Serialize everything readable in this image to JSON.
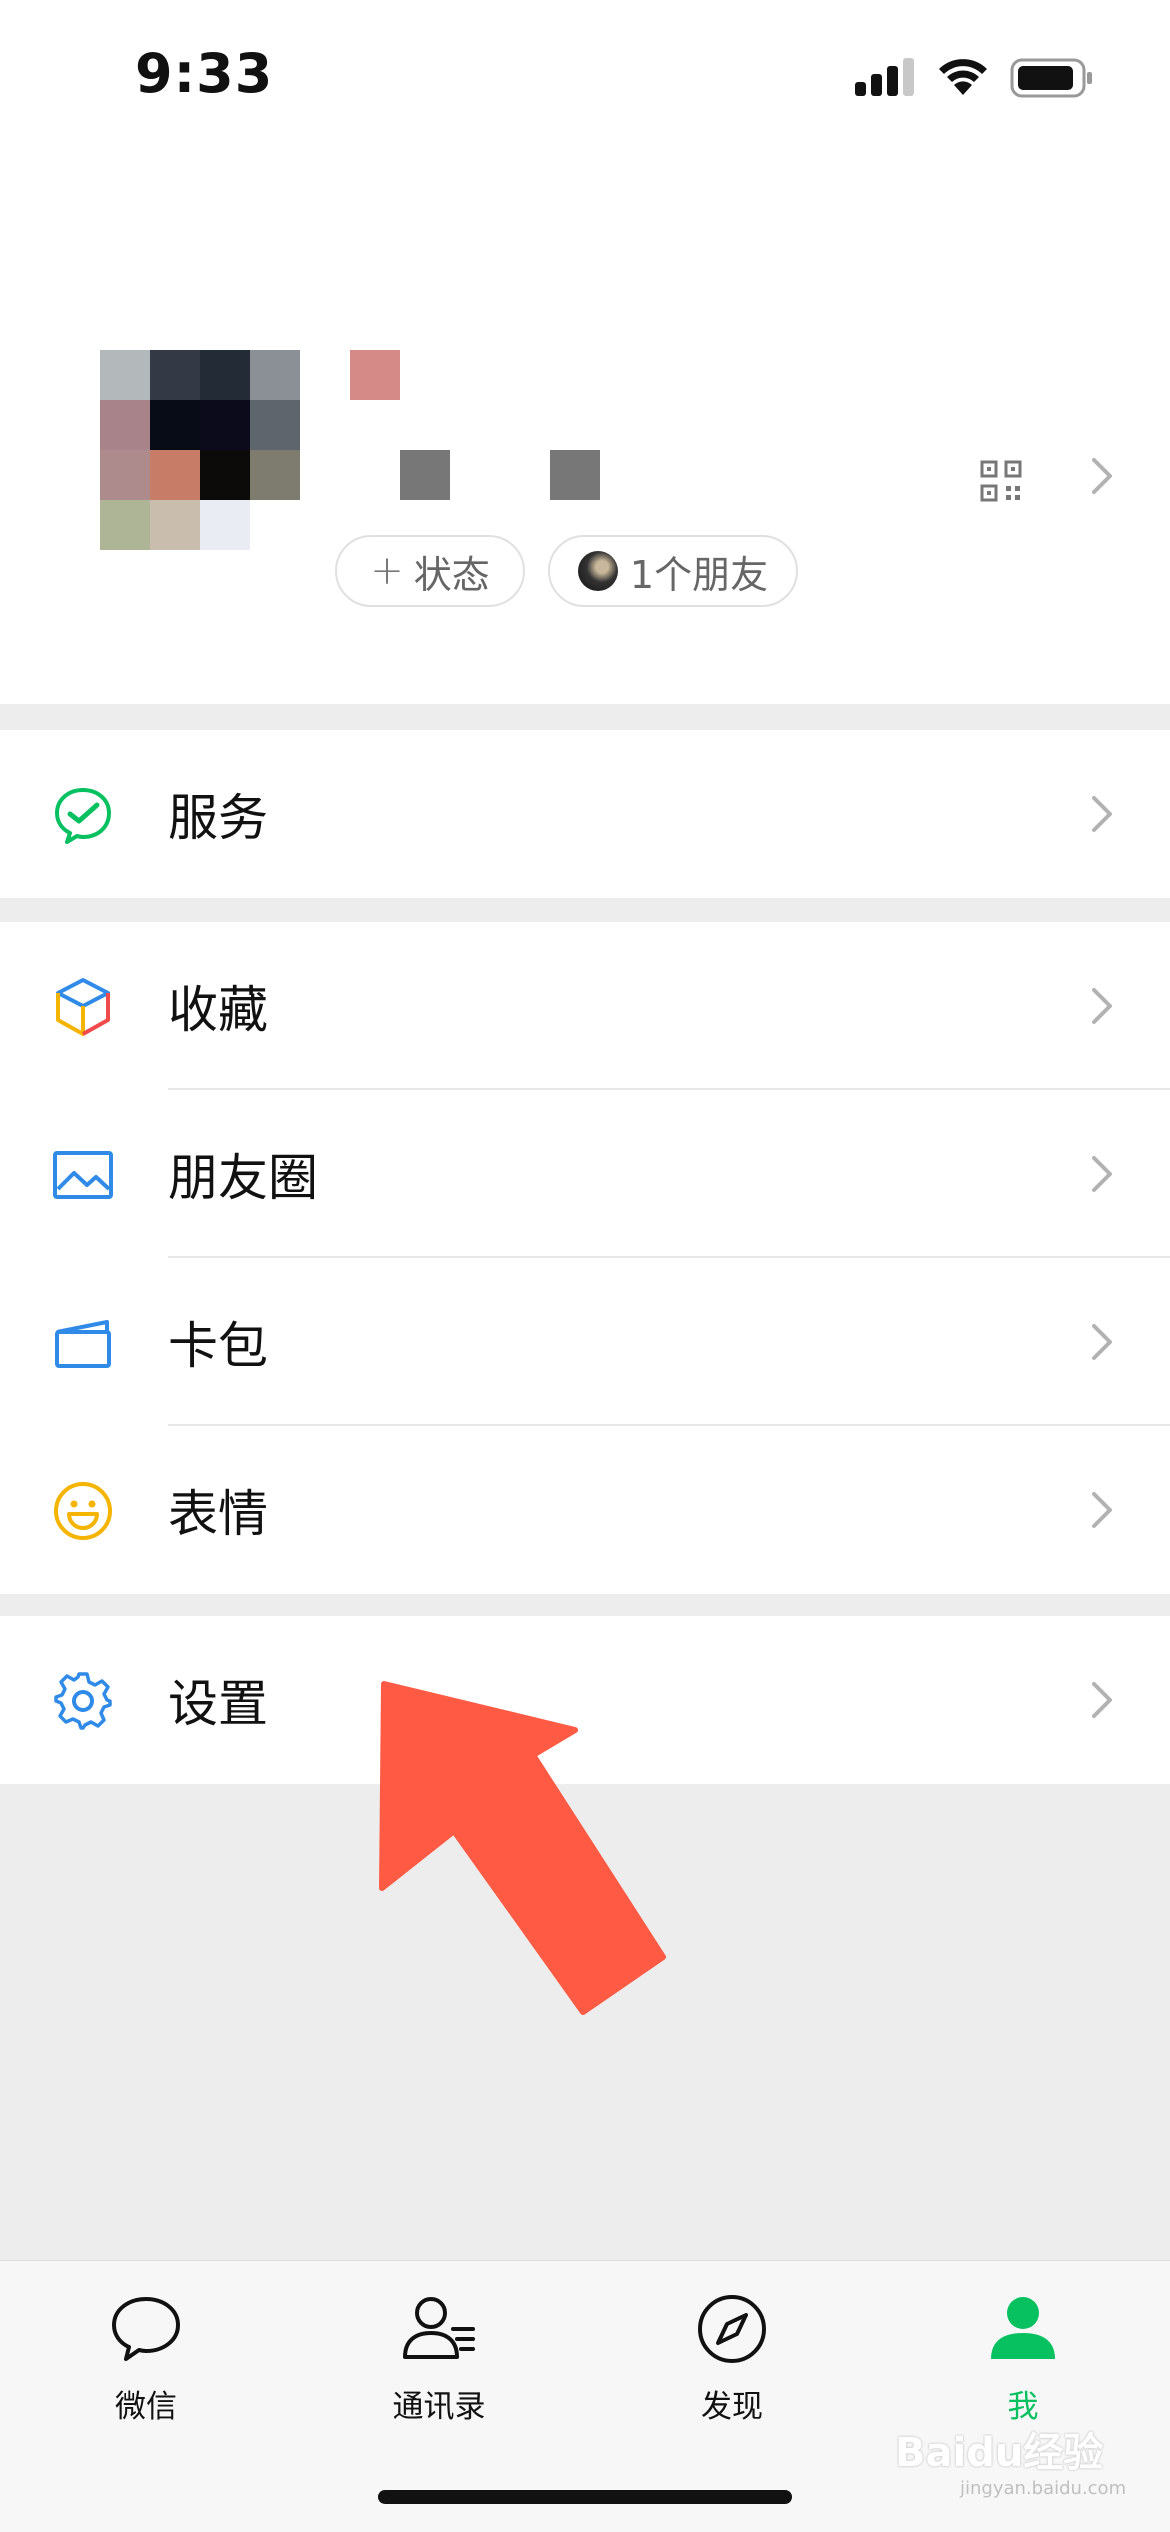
{
  "status_bar": {
    "time": "9:33"
  },
  "profile": {
    "status_chip_label": "状态",
    "friends_chip_label": "1个朋友"
  },
  "menu": {
    "service": "服务",
    "favorites": "收藏",
    "moments": "朋友圈",
    "cards": "卡包",
    "stickers": "表情",
    "settings": "设置"
  },
  "tabs": [
    {
      "label": "微信",
      "icon": "chat-bubble-icon"
    },
    {
      "label": "通讯录",
      "icon": "contacts-icon"
    },
    {
      "label": "发现",
      "icon": "compass-icon"
    },
    {
      "label": "我",
      "icon": "person-icon",
      "active": true
    }
  ],
  "watermark": {
    "text": "Baidu经验",
    "sub": "jingyan.baidu.com"
  },
  "colors": {
    "accent": "#07c160",
    "arrow": "#ff5a44",
    "background": "#ededed"
  }
}
